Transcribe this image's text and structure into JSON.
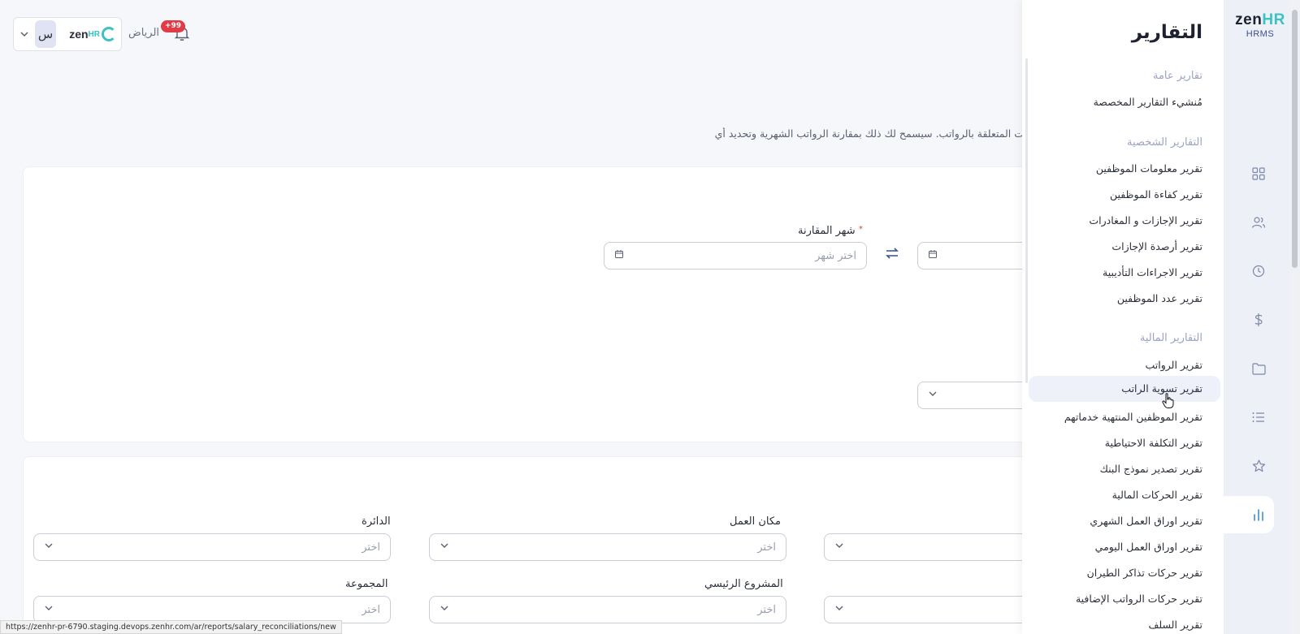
{
  "topbar": {
    "avatar_letter": "س",
    "logo_text": "zen",
    "logo_hr": "HR",
    "location": "الرياض",
    "notifications": "+99"
  },
  "description": "ت المتعلقة بالرواتب. سيسمح لك ذلك بمقارنة الرواتب الشهرية وتحديد أي",
  "form": {
    "compare_month_label": "شهر المقارنة",
    "compare_month_placeholder": "اختر شهر",
    "select_placeholder": "اختر",
    "fields": {
      "department": "الدائرة",
      "workplace": "مكان العمل",
      "group": "المجموعة",
      "main_project": "المشروع الرئيسي"
    }
  },
  "panel": {
    "title": "التقارير",
    "sections": [
      {
        "title": "تقارير عامة",
        "items": [
          "مُنشيء التقارير المخصصة"
        ]
      },
      {
        "title": "التقارير الشخصية",
        "items": [
          "تقرير معلومات الموظفين",
          "تقرير كفاءة الموظفين",
          "تقرير الإجازات و المغادرات",
          "تقرير أرصدة الإجازات",
          "تقرير الاجراءات التأديبية",
          "تقرير عدد الموظفين"
        ]
      },
      {
        "title": "التقارير المالية",
        "items": [
          "تقرير الرواتب",
          "تقرير تسوية الراتب",
          "تقرير الموظفين المنتهية خدماتهم",
          "تقرير التكلفة الاحتياطية",
          "تقرير تصدير نموذج البنك",
          "تقرير الحركات المالية",
          "تقرير اوراق العمل الشهري",
          "تقرير اوراق العمل اليومي",
          "تقرير حركات تذاكر الطيران",
          "تقرير حركات الرواتب الإضافية",
          "تقرير السلف"
        ]
      }
    ]
  },
  "nav": {
    "brand_zen": "zen",
    "brand_hr": "HR",
    "brand_sub": "HRMS",
    "icons": [
      "dashboard-icon",
      "people-icon",
      "clock-icon",
      "dollar-icon",
      "folder-icon",
      "list-icon",
      "star-icon",
      "chart-icon"
    ]
  },
  "status_url": "https://zenhr-pr-6790.staging.devops.zenhr.com/ar/reports/salary_reconciliations/new",
  "colors": {
    "accent": "#3cc2c2",
    "badge": "#e03b46",
    "active_bg": "#eef0fa"
  }
}
